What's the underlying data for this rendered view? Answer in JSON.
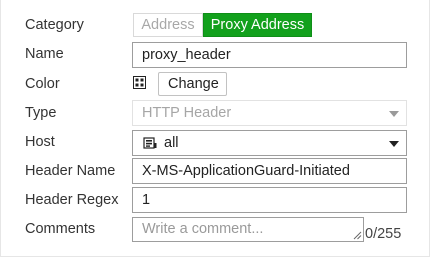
{
  "form": {
    "category": {
      "label": "Category",
      "options": [
        "Address",
        "Proxy Address"
      ],
      "selected": "Proxy Address"
    },
    "name": {
      "label": "Name",
      "value": "proxy_header"
    },
    "color": {
      "label": "Color",
      "button_label": "Change",
      "icon": "color-swatch-icon"
    },
    "type": {
      "label": "Type",
      "value": "HTTP Header",
      "disabled": true
    },
    "host": {
      "label": "Host",
      "value": "all",
      "icon": "address-object-icon"
    },
    "header_name": {
      "label": "Header Name",
      "value": "X-MS-ApplicationGuard-Initiated"
    },
    "header_regex": {
      "label": "Header Regex",
      "value": "1"
    },
    "comments": {
      "label": "Comments",
      "placeholder": "Write a comment...",
      "counter": "0/255"
    }
  },
  "colors": {
    "accent_green": "#12a01c",
    "border": "#9d9d9d"
  }
}
